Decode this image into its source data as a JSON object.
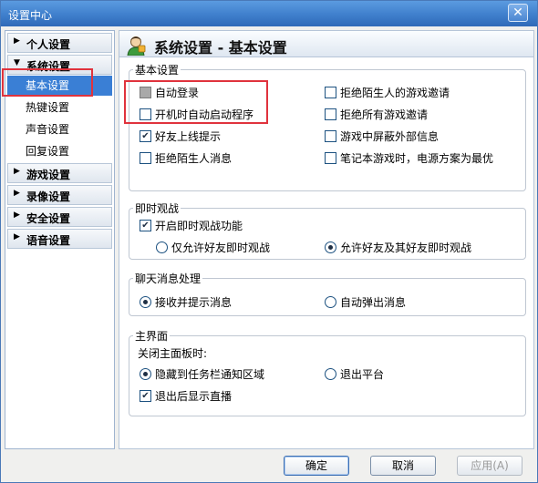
{
  "window": {
    "title": "设置中心",
    "close_glyph": "✕"
  },
  "sidebar": {
    "personal": "个人设置",
    "system": "系统设置",
    "system_items": [
      "基本设置",
      "热键设置",
      "声音设置",
      "回复设置"
    ],
    "game": "游戏设置",
    "record": "录像设置",
    "security": "安全设置",
    "voice": "语音设置"
  },
  "header": {
    "title": "系统设置 - 基本设置",
    "icon": "user-avatar-icon"
  },
  "basic": {
    "legend": "基本设置",
    "auto_login": "自动登录",
    "auto_start": "开机时自动启动程序",
    "friend_online": "好友上线提示",
    "reject_stranger_msg": "拒绝陌生人消息",
    "reject_stranger_invite": "拒绝陌生人的游戏邀请",
    "reject_all_invite": "拒绝所有游戏邀请",
    "block_external_info": "游戏中屏蔽外部信息",
    "laptop_power": "笔记本游戏时，电源方案为最优"
  },
  "live": {
    "legend": "即时观战",
    "enable": "开启即时观战功能",
    "friends_only": "仅允许好友即时观战",
    "friends_and_fof": "允许好友及其好友即时观战"
  },
  "chat": {
    "legend": "聊天消息处理",
    "receive_prompt": "接收并提示消息",
    "auto_popup": "自动弹出消息"
  },
  "mainface": {
    "legend": "主界面",
    "close_label": "关闭主面板时:",
    "hide_tray": "隐藏到任务栏通知区域",
    "exit_platform": "退出平台",
    "show_live_after_exit": "退出后显示直播"
  },
  "buttons": {
    "ok": "确定",
    "cancel": "取消",
    "apply": "应用(A)"
  },
  "colors": {
    "selection": "#3a7fd5",
    "highlight_box": "#e0333d",
    "title_bar": "#3f7fcc"
  }
}
